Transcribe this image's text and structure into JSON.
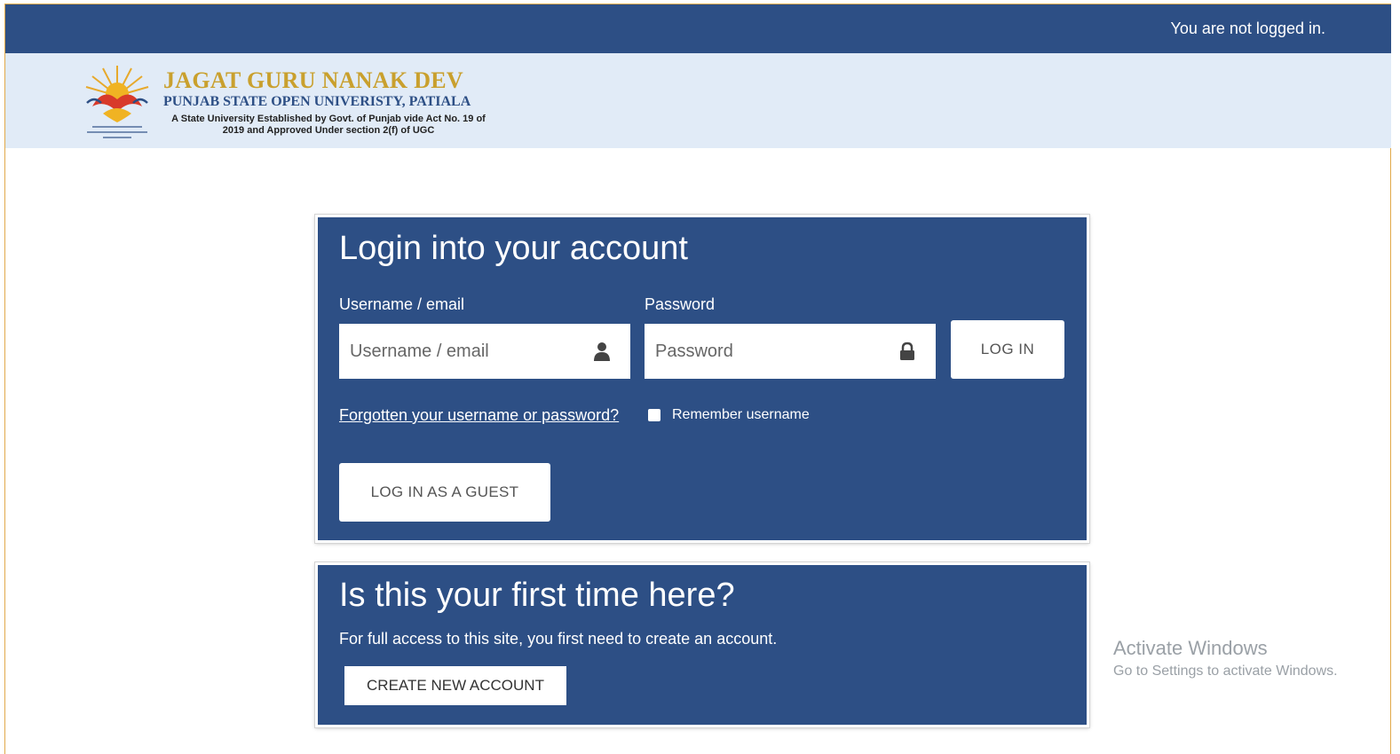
{
  "topbar": {
    "login_status": "You are not logged in."
  },
  "header": {
    "title": "JAGAT GURU NANAK DEV",
    "subtitle": "PUNJAB STATE OPEN UNIVERISTY, PATIALA",
    "description": "A State University Established by Govt. of Punjab vide Act No. 19 of 2019 and Approved Under section 2(f) of UGC"
  },
  "login": {
    "heading": "Login into your account",
    "username_label": "Username / email",
    "username_placeholder": "Username / email",
    "username_value": "",
    "password_label": "Password",
    "password_placeholder": "Password",
    "password_value": "",
    "login_button": "LOG IN",
    "forgot_link": "Forgotten your username or password?",
    "remember_label": "Remember username",
    "remember_checked": false,
    "guest_button": "LOG IN AS A GUEST"
  },
  "signup": {
    "heading": "Is this your first time here?",
    "text": "For full access to this site, you first need to create an account.",
    "create_button": "CREATE NEW ACCOUNT"
  },
  "watermark": {
    "title": "Activate Windows",
    "subtitle": "Go to Settings to activate Windows."
  },
  "icons": {
    "username_field": "user-icon",
    "password_field": "lock-icon",
    "logo": "university-emblem-icon"
  },
  "colors": {
    "primary": "#2d4f85",
    "header_bg": "#e1ebf7",
    "brand_gold": "#c9a02e",
    "frame_border": "#e1a94a"
  }
}
